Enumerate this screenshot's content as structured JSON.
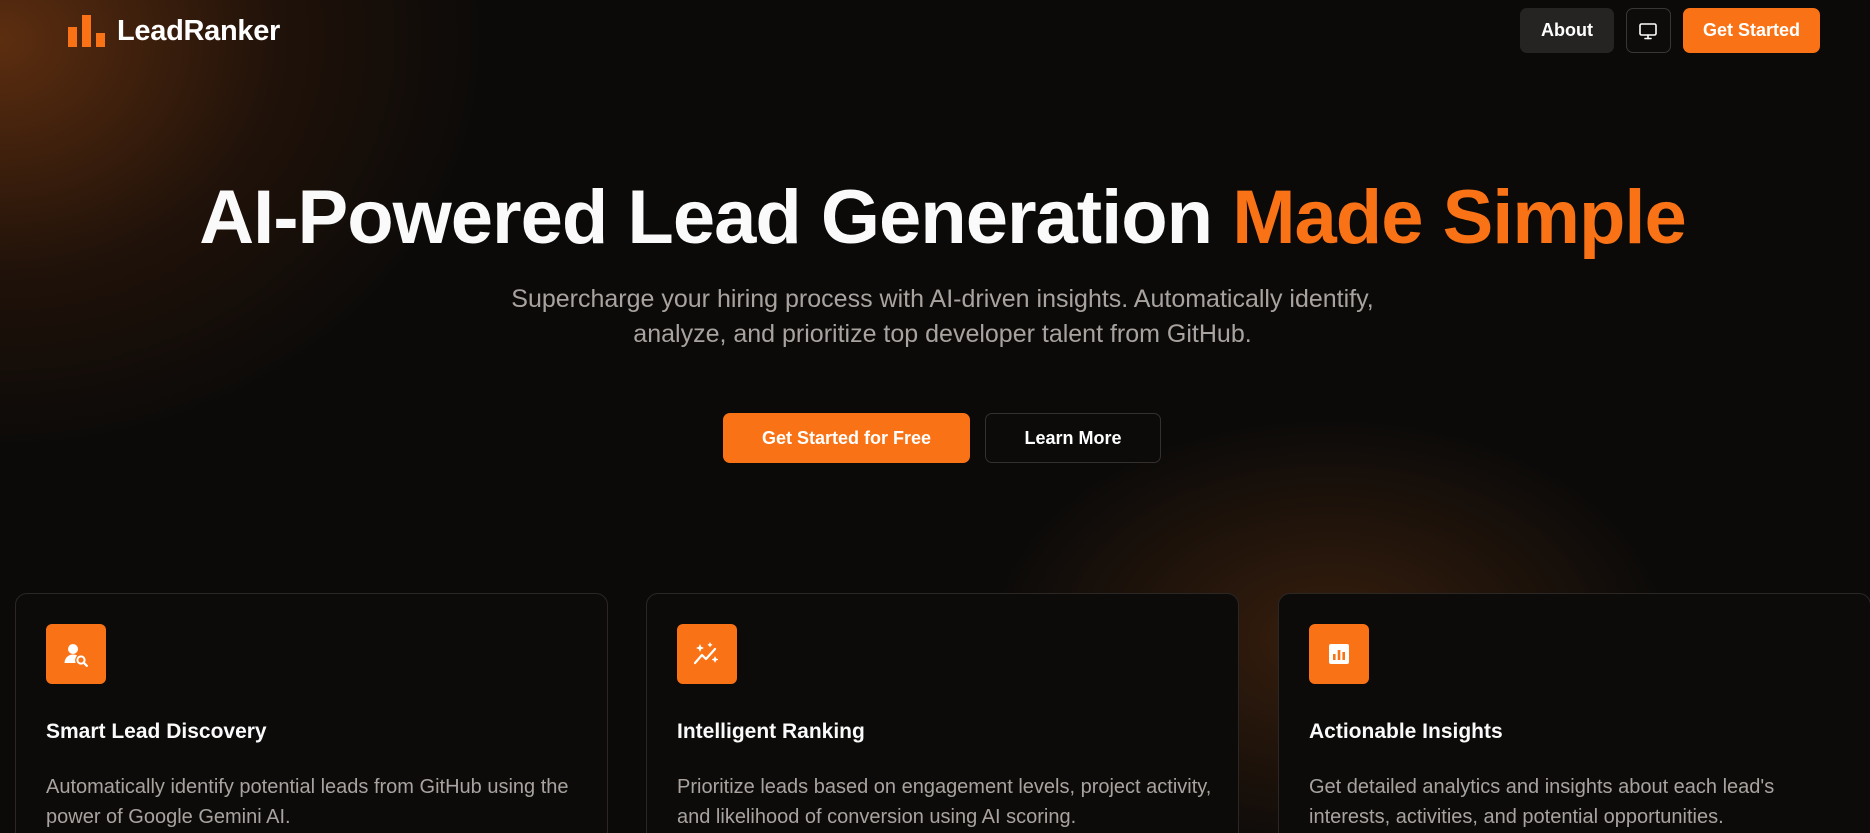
{
  "brand": {
    "name": "LeadRanker",
    "logo_icon": "bar-chart-icon",
    "accent_color": "#f97316"
  },
  "nav": {
    "about_label": "About",
    "theme_toggle_icon": "monitor-icon",
    "get_started_label": "Get Started"
  },
  "hero": {
    "title_main": "AI-Powered Lead Generation",
    "title_accent": "Made Simple",
    "subtitle": "Supercharge your hiring process with AI-driven insights. Automatically identify, analyze, and prioritize top developer talent from GitHub.",
    "primary_cta": "Get Started for Free",
    "secondary_cta": "Learn More"
  },
  "features": [
    {
      "icon": "user-search-icon",
      "title": "Smart Lead Discovery",
      "description": "Automatically identify potential leads from GitHub using the power of Google Gemini AI."
    },
    {
      "icon": "sparkle-trend-icon",
      "title": "Intelligent Ranking",
      "description": "Prioritize leads based on engagement levels, project activity, and likelihood of conversion using AI scoring."
    },
    {
      "icon": "analytics-icon",
      "title": "Actionable Insights",
      "description": "Get detailed analytics and insights about each lead's interests, activities, and potential opportunities."
    }
  ]
}
